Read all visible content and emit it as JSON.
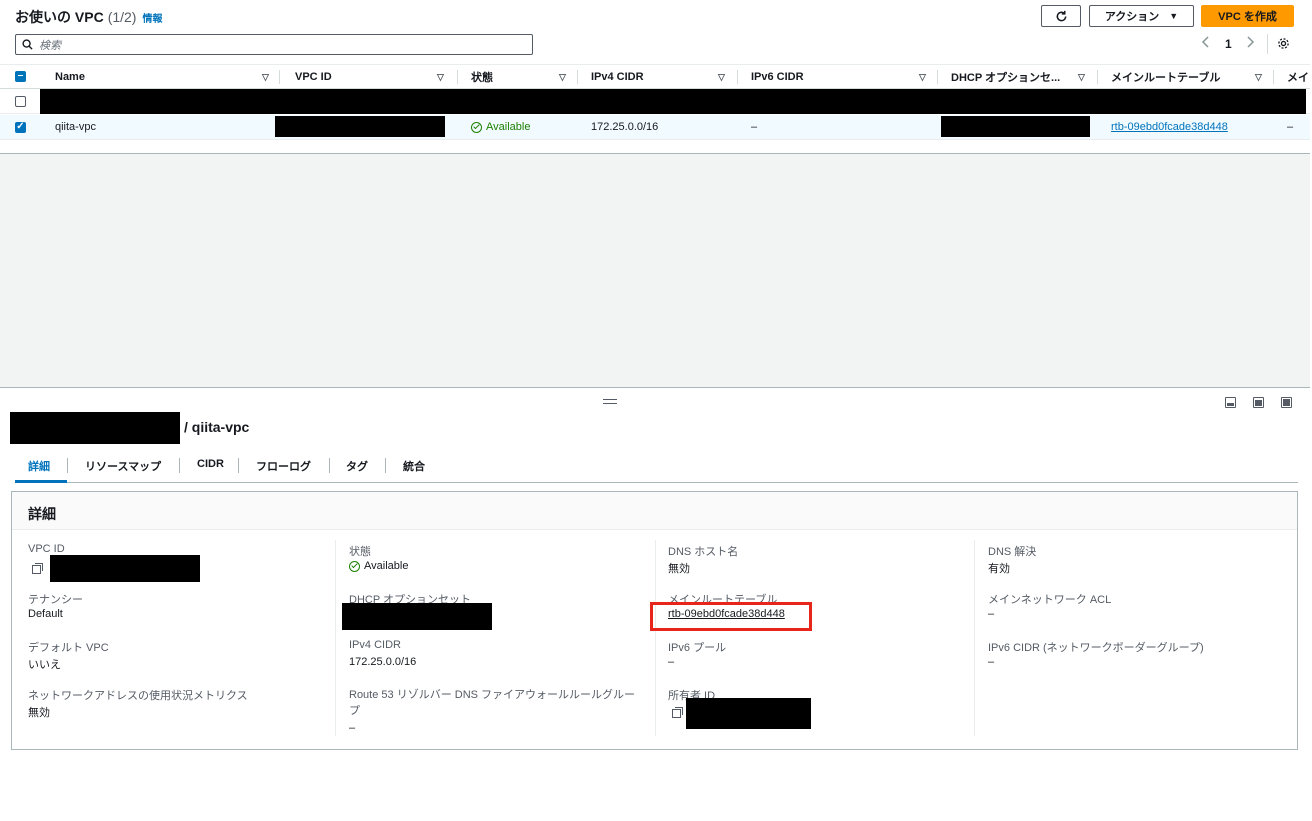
{
  "header": {
    "title": "お使いの VPC",
    "count": "(1/2)",
    "info": "情報",
    "actions_label": "アクション",
    "create_label": "VPC を作成",
    "search_placeholder": "検索",
    "page": "1"
  },
  "columns": [
    "Name",
    "VPC ID",
    "状態",
    "IPv4 CIDR",
    "IPv6 CIDR",
    "DHCP オプションセ...",
    "メインルートテーブル",
    "メイ"
  ],
  "rows": [
    {
      "name": "",
      "vpc_id": "",
      "state": "",
      "ipv4": "",
      "ipv6": "",
      "dhcp": "",
      "route_table": "",
      "extra": "",
      "checked": false
    },
    {
      "name": "qiita-vpc",
      "vpc_id": "",
      "state": "Available",
      "ipv4": "172.25.0.0/16",
      "ipv6": "–",
      "dhcp": "",
      "route_table": "rtb-09ebd0fcade38d448",
      "extra": "–",
      "checked": true
    }
  ],
  "detail": {
    "title": "/ qiita-vpc",
    "tabs": [
      "詳細",
      "リソースマップ",
      "CIDR",
      "フローログ",
      "タグ",
      "統合"
    ],
    "panel_title": "詳細",
    "col1": [
      {
        "key": "VPC ID",
        "value": ""
      },
      {
        "key": "テナンシー",
        "value": "Default"
      },
      {
        "key": "デフォルト VPC",
        "value": "いいえ"
      },
      {
        "key": "ネットワークアドレスの使用状況メトリクス",
        "value": "無効"
      }
    ],
    "col2": [
      {
        "key": "状態",
        "value": "Available"
      },
      {
        "key": "DHCP オプションセット",
        "value": ""
      },
      {
        "key": "IPv4 CIDR",
        "value": "172.25.0.0/16"
      },
      {
        "key": "Route 53 リゾルバー DNS ファイアウォールルールグループ",
        "value": "–"
      }
    ],
    "col3": [
      {
        "key": "DNS ホスト名",
        "value": "無効"
      },
      {
        "key": "メインルートテーブル",
        "value": "rtb-09ebd0fcade38d448"
      },
      {
        "key": "IPv6 プール",
        "value": "–"
      },
      {
        "key": "所有者 ID",
        "value": ""
      }
    ],
    "col4": [
      {
        "key": "DNS 解決",
        "value": "有効"
      },
      {
        "key": "メインネットワーク ACL",
        "value": "–"
      },
      {
        "key": "IPv6 CIDR (ネットワークボーダーグループ)",
        "value": "–"
      }
    ]
  },
  "colors": {
    "primary": "#ff9900",
    "link": "#0073bb",
    "success": "#1d8102",
    "highlight": "#e8251a"
  }
}
